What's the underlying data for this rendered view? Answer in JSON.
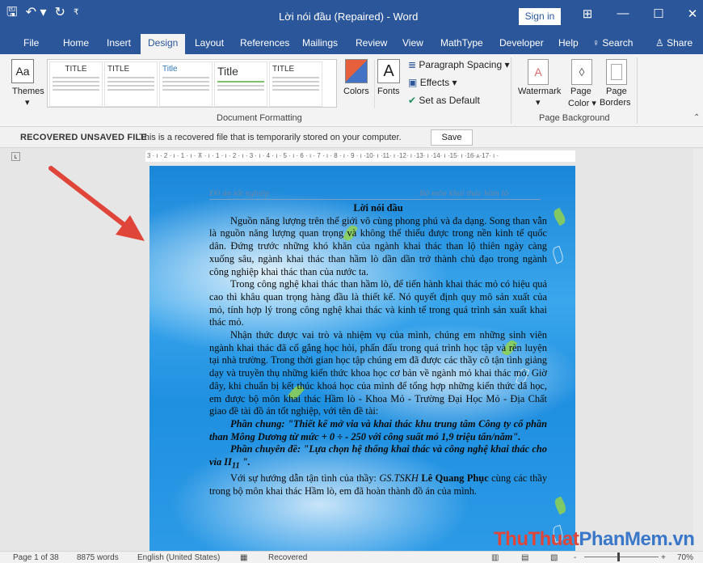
{
  "title_bar": {
    "document_title": "Lời nói đầu (Repaired)  -  Word",
    "sign_in": "Sign in",
    "icons": [
      "save-icon",
      "undo-icon",
      "redo-icon",
      "customize-qat-icon",
      "ribbon-display-icon",
      "minimize-icon",
      "maximize-icon",
      "close-icon"
    ]
  },
  "tabs": [
    {
      "label": "File"
    },
    {
      "label": "Home"
    },
    {
      "label": "Insert"
    },
    {
      "label": "Design",
      "active": true
    },
    {
      "label": "Layout"
    },
    {
      "label": "References"
    },
    {
      "label": "Mailings"
    },
    {
      "label": "Review"
    },
    {
      "label": "View"
    },
    {
      "label": "MathType"
    },
    {
      "label": "Developer"
    },
    {
      "label": "Help"
    }
  ],
  "tell_me": "Search",
  "share": "Share",
  "ribbon": {
    "themes": "Themes",
    "style_gallery": [
      {
        "title": "TITLE"
      },
      {
        "title": "TITLE"
      },
      {
        "title": "Title"
      },
      {
        "title": "Title"
      },
      {
        "title": "TITLE"
      }
    ],
    "colors": "Colors",
    "fonts": "Fonts",
    "paragraph_spacing": "Paragraph Spacing",
    "effects": "Effects",
    "set_as_default": "Set as Default",
    "group_document_formatting": "Document Formatting",
    "watermark": "Watermark",
    "page_color_1": "Page",
    "page_color_2": "Color",
    "page_borders_1": "Page",
    "page_borders_2": "Borders",
    "group_page_background": "Page Background"
  },
  "message_bar": {
    "title": "RECOVERED UNSAVED FILE",
    "text": "This is a recovered file that is temporarily stored on your computer.",
    "save": "Save"
  },
  "ruler": "3 · ı · 2 · ı · 1 · ı · ⊼ · ı · 1 · ı · 2 · ı · 3 · ı · 4 · ı · 5 · ı · 6 · ı · 7 · ı · 8 · ı · 9 · ı ·10· ı ·11· ı ·12· ı ·13· ı ·14· ı ·15· ı ·16·⩓·17· ı ·",
  "document": {
    "header_left": "Đồ án tốt nghiệp",
    "header_right": "Bộ môn khai thác hầm lò",
    "heading": "Lời nói đầu",
    "p1": "Nguồn năng lượng trên thế giới vô cùng phong phú và đa dạng. Song than vẫn là nguồn năng lượng quan trọng và không thể thiếu được trong nền kinh tế quốc dân. Đứng trước những khó khăn của ngành khai thác than lộ thiên ngày càng xuống sâu, ngành khai thác than hầm lò dần dần trở thành chủ đạo trong ngành công nghiệp khai thác than của nước ta.",
    "p2": "Trong công nghệ khai thác than hầm lò, để tiến hành khai thác mỏ có hiệu quả cao thì khâu quan trọng hàng đầu là thiết kế.  Nó quyết định quy mô sản xuất của mỏ, tính hợp lý trong công nghệ khai thác và kinh tế trong quá trình sản xuất khai thác mỏ.",
    "p3": "Nhận thức được vai trò và nhiệm vụ của mình, chúng em những sinh viên ngành khai thác đã cố gắng học hỏi, phấn đấu trong quá trình học tập và rèn luyện tại nhà trường. Trong thời gian học tập chúng em đã được các thầy cô tận tình giảng dạy và truyền thụ những kiến thức khoa học cơ bản về ngành mỏ khai thác mỏ. Giờ đây, khi chuẩn bị kết thúc khoá học của mình để tổng hợp những kiến thức đã học, em được bộ môn khai thác Hầm lò - Khoa Mỏ - Trường Đại Học Mỏ - Địa Chất giao đề tài đồ án tốt nghiệp, với tên đề tài:",
    "p4": "Phần chung: \"Thiết kế mở via và khai thác khu trung tâm Công ty cổ phần than Mông Dương từ mức + 0 ÷ - 250 với công suất mỏ 1,9 triệu tấn/năm\".",
    "p5_a": "Phần chuyên đề: \"Lựa chọn hệ thống khai thác và công nghệ khai thác cho vỉa II",
    "p5_sub": "11",
    "p5_b": " \".",
    "p6_a": "Với sự hướng dẫn tận tình của thầy: ",
    "p6_b": "GS.TSKH",
    "p6_c": " Lê Quang Phục",
    "p6_d": " cùng các thầy trong bộ môn khai thác Hầm lò, em đã hoàn thành đồ án của mình."
  },
  "status_bar": {
    "page": "Page 1 of 38",
    "words": "8875 words",
    "language": "English (United States)",
    "state": "Recovered",
    "zoom": "70%",
    "zoom_minus": "-",
    "zoom_plus": "+"
  },
  "watermark": {
    "part1": "Thu",
    "part2": "Thuat",
    "part3": "PhanMem",
    "part4": ".vn"
  },
  "colors": {
    "accent": "#2b579a",
    "arrow": "#e0453a"
  }
}
